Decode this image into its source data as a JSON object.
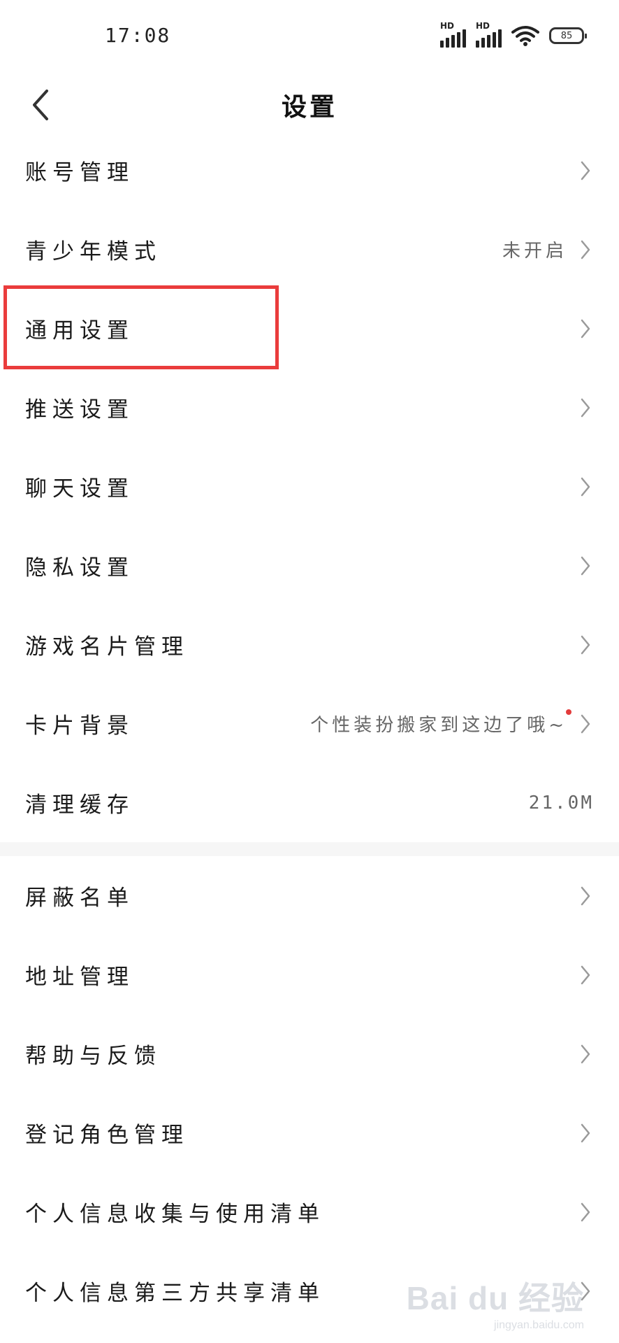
{
  "status_bar": {
    "time": "17:08",
    "signal_1_label": "HD",
    "signal_2_label": "HD",
    "battery": "85",
    "icons": [
      "hd-signal-icon",
      "hd-signal-icon",
      "wifi-icon",
      "battery-icon"
    ]
  },
  "header": {
    "title": "设置",
    "back_icon": "chevron-left-icon"
  },
  "settings": {
    "items": [
      {
        "label": "账号管理"
      },
      {
        "label": "青少年模式",
        "value": "未开启"
      },
      {
        "label": "通用设置"
      },
      {
        "label": "推送设置"
      },
      {
        "label": "聊天设置"
      },
      {
        "label": "隐私设置"
      },
      {
        "label": "游戏名片管理"
      },
      {
        "label": "卡片背景",
        "value": "个性装扮搬家到这边了哦~"
      },
      {
        "label": "清理缓存",
        "value": "21.0M"
      }
    ],
    "items2": [
      {
        "label": "屏蔽名单"
      },
      {
        "label": "地址管理"
      },
      {
        "label": "帮助与反馈"
      },
      {
        "label": "登记角色管理"
      },
      {
        "label": "个人信息收集与使用清单"
      },
      {
        "label": "个人信息第三方共享清单"
      }
    ]
  },
  "watermark": {
    "main": "Bai du 经验",
    "sub": "jingyan.baidu.com"
  },
  "colors": {
    "highlight": "#ea3c3c",
    "red_dot": "#e33b3b",
    "chevron": "#9a9a9a"
  }
}
